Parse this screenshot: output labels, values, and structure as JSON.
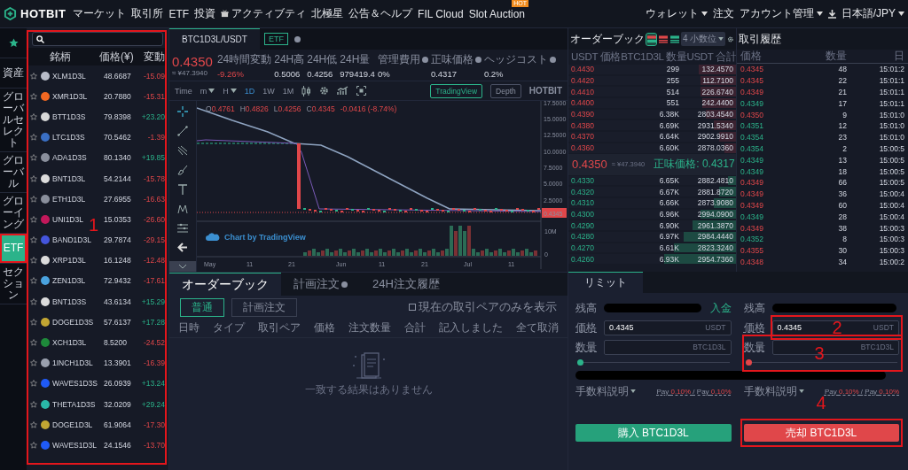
{
  "nav": {
    "logo": "HOTBIT",
    "items": [
      {
        "label": "マーケット",
        "kind": "plain"
      },
      {
        "label": "取引所",
        "kind": "plain"
      },
      {
        "label": "ETF",
        "kind": "plain"
      },
      {
        "label": "投資",
        "kind": "plain"
      },
      {
        "label": "アクティブティ",
        "kind": "gift"
      },
      {
        "label": "北極星",
        "kind": "plain"
      },
      {
        "label": "公告＆ヘルプ",
        "kind": "plain"
      },
      {
        "label": "FIL Cloud",
        "kind": "plain"
      },
      {
        "label": "Slot Auction",
        "kind": "plain",
        "badge": "HOT"
      }
    ],
    "right_items": [
      {
        "kind": "link",
        "label": "ウォレット",
        "dropdown": true
      },
      {
        "kind": "link",
        "label": "注文",
        "dropdown": false
      },
      {
        "kind": "link",
        "label": "アカウント管理",
        "dropdown": true
      },
      {
        "kind": "download"
      },
      {
        "kind": "link",
        "label": "日本語/JPY",
        "dropdown": true
      }
    ]
  },
  "sidebar": {
    "items": [
      {
        "kind": "star",
        "selected": false
      },
      {
        "kind": "text",
        "label": "資産",
        "selected": false
      },
      {
        "kind": "text",
        "label": "グローバルセレクト",
        "selected": false
      },
      {
        "kind": "text",
        "label": "グローバル",
        "selected": false
      },
      {
        "kind": "text",
        "label": "グローイング",
        "selected": false
      },
      {
        "kind": "text",
        "label": "ETF",
        "selected": true
      },
      {
        "kind": "text",
        "label": "セクション",
        "selected": false
      }
    ]
  },
  "market": {
    "columns": [
      "銘柄",
      "価格(¥)",
      "変動"
    ],
    "rows": [
      {
        "name": "XLM1D3L",
        "price": "48.6687",
        "change": "-15.09",
        "rising": false,
        "color": "#b8bcc8"
      },
      {
        "name": "XMR1D3L",
        "price": "20.7880",
        "change": "-15.31",
        "rising": false,
        "color": "#f26822"
      },
      {
        "name": "BTT1D3S",
        "price": "79.8398",
        "change": "+23.20",
        "rising": true,
        "color": "#d8d8d8"
      },
      {
        "name": "LTC1D3S",
        "price": "70.5462",
        "change": "-1.39",
        "rising": false,
        "color": "#3a6fc4"
      },
      {
        "name": "ADA1D3S",
        "price": "80.1340",
        "change": "+19.85",
        "rising": true,
        "color": "#8a8f9c"
      },
      {
        "name": "BNT1D3L",
        "price": "54.2144",
        "change": "-15.78",
        "rising": false,
        "color": "#dcdcdc"
      },
      {
        "name": "ETH1D3L",
        "price": "27.6955",
        "change": "-16.63",
        "rising": false,
        "color": "#8a8f9c"
      },
      {
        "name": "UNI1D3L",
        "price": "15.0353",
        "change": "-26.60",
        "rising": false,
        "color": "#c2185b"
      },
      {
        "name": "BAND1D3L",
        "price": "29.7874",
        "change": "-29.15",
        "rising": false,
        "color": "#4455dd"
      },
      {
        "name": "XRP1D3L",
        "price": "16.1248",
        "change": "-12.48",
        "rising": false,
        "color": "#dcdcdc"
      },
      {
        "name": "ZEN1D3L",
        "price": "72.9432",
        "change": "-17.61",
        "rising": false,
        "color": "#4aa3df"
      },
      {
        "name": "BNT1D3S",
        "price": "43.6134",
        "change": "+15.29",
        "rising": true,
        "color": "#dcdcdc"
      },
      {
        "name": "DOGE1D3S",
        "price": "57.6137",
        "change": "+17.28",
        "rising": true,
        "color": "#c2a633"
      },
      {
        "name": "XCH1D3L",
        "price": "8.5200",
        "change": "-24.52",
        "rising": false,
        "color": "#1e8a3a"
      },
      {
        "name": "1INCH1D3L",
        "price": "13.3901",
        "change": "-16.39",
        "rising": false,
        "color": "#9aa0ae"
      },
      {
        "name": "WAVES1D3S",
        "price": "26.0939",
        "change": "+13.24",
        "rising": true,
        "color": "#1f5af6"
      },
      {
        "name": "THETA1D3S",
        "price": "32.0209",
        "change": "+29.24",
        "rising": true,
        "color": "#2ab8a8"
      },
      {
        "name": "DOGE1D3L",
        "price": "61.9064",
        "change": "-17.30",
        "rising": false,
        "color": "#c2a633"
      },
      {
        "name": "WAVES1D3L",
        "price": "24.1546",
        "change": "-13.70",
        "rising": false,
        "color": "#1f5af6"
      }
    ]
  },
  "pair": {
    "tab": "BTC1D3L/USDT",
    "tag": "ETF",
    "price": "0.4350",
    "fiat": "≈ ¥47.3940",
    "stats": [
      {
        "label": "24時間変動",
        "value": "-9.26%",
        "help": false,
        "negative": true
      },
      {
        "label": "24H高",
        "value": "0.5006",
        "help": false,
        "negative": false
      },
      {
        "label": "24H低",
        "value": "0.4256",
        "help": false,
        "negative": false
      },
      {
        "label": "24H量",
        "value": "979419.4",
        "help": false,
        "negative": false
      },
      {
        "label": "管理費用",
        "value": "0%",
        "help": true,
        "negative": false
      },
      {
        "label": "正味価格",
        "value": "0.4317",
        "help": true,
        "negative": false
      },
      {
        "label": "ヘッジコスト",
        "value": "0.2%",
        "help": true,
        "negative": false
      }
    ]
  },
  "chart": {
    "intervals": [
      {
        "label": "Time",
        "kind": "text",
        "selected": false
      },
      {
        "label": "m",
        "kind": "dropdown",
        "selected": false
      },
      {
        "label": "H",
        "kind": "dropdown",
        "selected": false
      },
      {
        "label": "1D",
        "kind": "text",
        "selected": true
      },
      {
        "label": "1W",
        "kind": "text",
        "selected": false
      },
      {
        "label": "1M",
        "kind": "text",
        "selected": false
      }
    ],
    "views": [
      {
        "label": "TradingView",
        "selected": true
      },
      {
        "label": "Depth",
        "selected": false
      }
    ],
    "brand": "HOTBIT",
    "legend": [
      {
        "label": "O",
        "value": "0.4761"
      },
      {
        "label": "H",
        "value": "0.4826"
      },
      {
        "label": "L",
        "value": "0.4256"
      },
      {
        "label": "C",
        "value": "0.4345"
      },
      {
        "value": "-0.0416 (-8.74%)"
      }
    ],
    "y_labels": [
      "17.5000",
      "15.0000",
      "12.5000",
      "10.0000",
      "7.5000",
      "5.0000",
      "2.5000"
    ],
    "price_tag": "0.4345",
    "volume_labels": [
      "10M",
      "0"
    ],
    "x_labels": [
      "May",
      "11",
      "21",
      "Jun",
      "11",
      "21",
      "Jul",
      "11"
    ],
    "credit": "Chart by TradingView"
  },
  "orders": {
    "tabs": [
      {
        "label": "オーダーブック",
        "help": false,
        "selected": true
      },
      {
        "label": "計画注文",
        "help": true,
        "selected": false
      },
      {
        "label": "24H注文履歴",
        "help": false,
        "selected": false
      }
    ],
    "modes": [
      {
        "label": "普通",
        "selected": true
      },
      {
        "label": "計画注文",
        "selected": false
      }
    ],
    "filter": {
      "label": "現在の取引ペアのみを表示",
      "checked": false
    },
    "columns": [
      "日時",
      "タイプ",
      "取引ペア",
      "価格",
      "注文数量",
      "合計",
      "記入しました",
      "全て取消"
    ],
    "empty": "一致する結果はありません"
  },
  "orderbook": {
    "title": "オーダーブック",
    "views": [
      {
        "kind": "both",
        "selected": true
      },
      {
        "kind": "asks",
        "selected": false
      },
      {
        "kind": "bids",
        "selected": false
      }
    ],
    "precision": "4 小数位",
    "columns": [
      "USDT 価格",
      "BTC1D3L 数量",
      "USDT 合計"
    ],
    "asks": [
      {
        "price": "0.4430",
        "amount": "299",
        "total": "132.4570",
        "level": 0.22
      },
      {
        "price": "0.4420",
        "amount": "255",
        "total": "112.7100",
        "level": 0.21
      },
      {
        "price": "0.4410",
        "amount": "514",
        "total": "226.6740",
        "level": 0.21
      },
      {
        "price": "0.4400",
        "amount": "551",
        "total": "242.4400",
        "level": 0.2
      },
      {
        "price": "0.4390",
        "amount": "6.38K",
        "total": "2803.4540",
        "level": 0.18
      },
      {
        "price": "0.4380",
        "amount": "6.69K",
        "total": "2931.5340",
        "level": 0.13
      },
      {
        "price": "0.4370",
        "amount": "6.64K",
        "total": "2902.9910",
        "level": 0.1
      },
      {
        "price": "0.4360",
        "amount": "6.60K",
        "total": "2878.0360",
        "level": 0.07
      }
    ],
    "last_price": "0.4350",
    "last_fiat": "≈ ¥47.3940",
    "net_price": "正味価格: 0.4317",
    "bids": [
      {
        "price": "0.4330",
        "amount": "6.65K",
        "total": "2882.4810",
        "level": 0.05
      },
      {
        "price": "0.4320",
        "amount": "6.67K",
        "total": "2881.8720",
        "level": 0.1
      },
      {
        "price": "0.4310",
        "amount": "6.66K",
        "total": "2873.9080",
        "level": 0.13
      },
      {
        "price": "0.4300",
        "amount": "6.96K",
        "total": "2994.0900",
        "level": 0.21
      },
      {
        "price": "0.4290",
        "amount": "6.90K",
        "total": "2961.3870",
        "level": 0.26
      },
      {
        "price": "0.4280",
        "amount": "6.97K",
        "total": "2984.4440",
        "level": 0.31
      },
      {
        "price": "0.4270",
        "amount": "6.61K",
        "total": "2823.3240",
        "level": 0.37
      },
      {
        "price": "0.4260",
        "amount": "6.93K",
        "total": "2954.7360",
        "level": 0.43
      }
    ]
  },
  "trades": {
    "title": "取引履歴",
    "columns": [
      "価格",
      "数量",
      "日"
    ],
    "rows": [
      {
        "price": "0.4345",
        "amount": "48",
        "time": "15:01:2",
        "buy": false
      },
      {
        "price": "0.4345",
        "amount": "22",
        "time": "15:01:1",
        "buy": false
      },
      {
        "price": "0.4349",
        "amount": "21",
        "time": "15:01:1",
        "buy": false
      },
      {
        "price": "0.4349",
        "amount": "17",
        "time": "15:01:1",
        "buy": true
      },
      {
        "price": "0.4350",
        "amount": "9",
        "time": "15:01:0",
        "buy": false
      },
      {
        "price": "0.4351",
        "amount": "12",
        "time": "15:01:0",
        "buy": true
      },
      {
        "price": "0.4354",
        "amount": "23",
        "time": "15:01:0",
        "buy": true
      },
      {
        "price": "0.4354",
        "amount": "2",
        "time": "15:00:5",
        "buy": true
      },
      {
        "price": "0.4349",
        "amount": "13",
        "time": "15:00:5",
        "buy": true
      },
      {
        "price": "0.4349",
        "amount": "18",
        "time": "15:00:5",
        "buy": true
      },
      {
        "price": "0.4349",
        "amount": "66",
        "time": "15:00:5",
        "buy": false
      },
      {
        "price": "0.4349",
        "amount": "36",
        "time": "15:00:4",
        "buy": false
      },
      {
        "price": "0.4349",
        "amount": "60",
        "time": "15:00:4",
        "buy": false
      },
      {
        "price": "0.4349",
        "amount": "28",
        "time": "15:00:4",
        "buy": true
      },
      {
        "price": "0.4349",
        "amount": "38",
        "time": "15:00:3",
        "buy": false
      },
      {
        "price": "0.4352",
        "amount": "8",
        "time": "15:00:3",
        "buy": true
      },
      {
        "price": "0.4355",
        "amount": "30",
        "time": "15:00:3",
        "buy": false
      },
      {
        "price": "0.4348",
        "amount": "34",
        "time": "15:00:2",
        "buy": false
      }
    ]
  },
  "trade_form": {
    "tab": "リミット",
    "sides": [
      {
        "kind": "buy",
        "balance_label": "残高",
        "deposit": "入金",
        "price_label": "価格",
        "price": "0.4345",
        "price_unit": "USDT",
        "amount_label": "数量",
        "amount_unit": "BTC1D3L",
        "level": 0,
        "fee_label": "手数料説明",
        "fee": [
          {
            "kind": "plain",
            "text": "Pay"
          },
          {
            "kind": "rate",
            "text": "0.10%"
          },
          {
            "kind": "plain",
            "text": "/ Pay"
          },
          {
            "kind": "rate",
            "text": "0.10%"
          }
        ],
        "button": "購入 BTC1D3L"
      },
      {
        "kind": "sell",
        "balance_label": "残高",
        "price_label": "価格",
        "price": "0.4345",
        "price_unit": "USDT",
        "amount_label": "数量",
        "amount_unit": "BTC1D3L",
        "level": 0,
        "fee_label": "手数料説明",
        "fee": [
          {
            "kind": "plain",
            "text": "Pay"
          },
          {
            "kind": "rate",
            "text": "0.10%"
          },
          {
            "kind": "plain",
            "text": "/ Pay"
          },
          {
            "kind": "rate",
            "text": "0.10%"
          }
        ],
        "button": "売却 BTC1D3L"
      }
    ]
  },
  "annotations": [
    {
      "kind": "category_tab"
    },
    {
      "kind": "market_list",
      "label": "1"
    },
    {
      "kind": "sell_price",
      "label": "2"
    },
    {
      "kind": "sell_amount",
      "label": "3"
    },
    {
      "kind": "sell_button",
      "label": "4"
    }
  ]
}
